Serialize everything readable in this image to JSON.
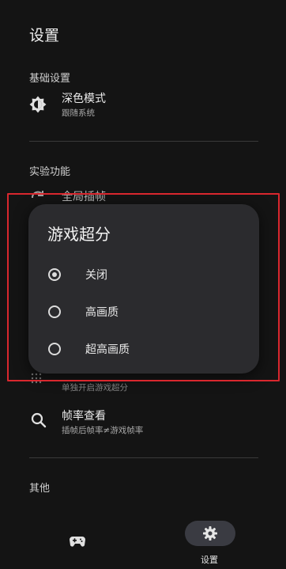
{
  "header": {
    "title": "设置"
  },
  "basic": {
    "section_title": "基础设置",
    "dark_mode": {
      "title": "深色模式",
      "subtitle": "跟随系统"
    }
  },
  "experimental": {
    "section_title": "实验功能",
    "global_interp": {
      "title": "全局插帧"
    },
    "game_sr": {
      "subtitle": "单独开启游戏超分"
    },
    "fps_view": {
      "title": "帧率查看",
      "subtitle": "插帧后帧率≠游戏帧率"
    }
  },
  "others": {
    "section_title": "其他"
  },
  "dialog": {
    "title": "游戏超分",
    "options": [
      {
        "label": "关闭",
        "checked": true
      },
      {
        "label": "高画质",
        "checked": false
      },
      {
        "label": "超高画质",
        "checked": false
      }
    ]
  },
  "bottom_nav": {
    "games": {
      "icon": "gamepad-icon"
    },
    "settings": {
      "label": "设置",
      "icon": "gear-icon",
      "selected": true
    }
  },
  "colors": {
    "highlight_border": "#d9272e",
    "dialog_bg": "#2b2b2e",
    "background": "#141414"
  }
}
